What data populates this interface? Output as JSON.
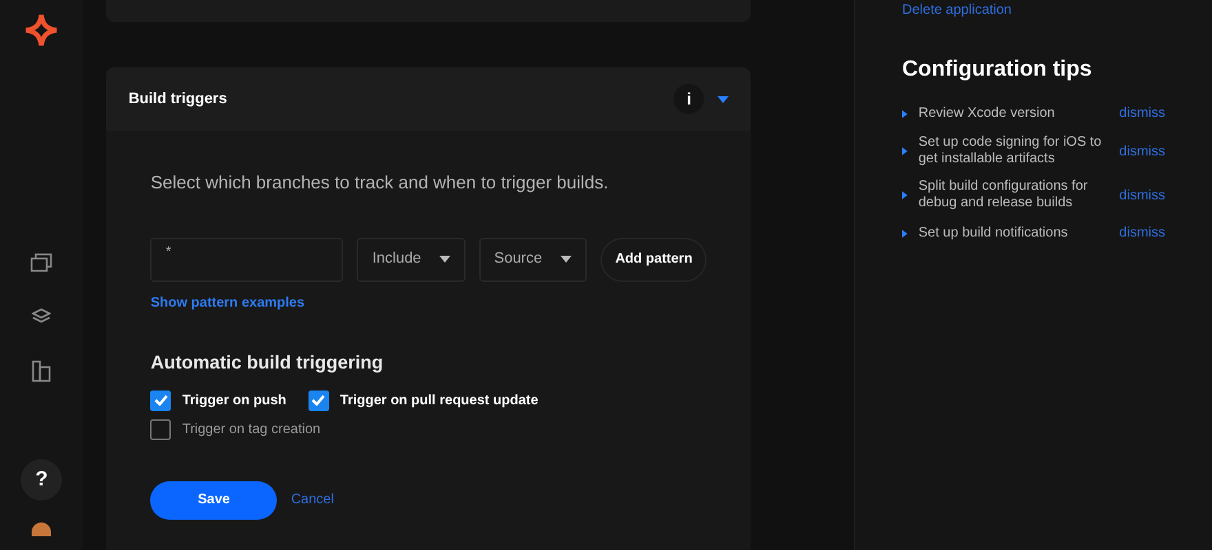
{
  "card": {
    "title": "Build triggers",
    "info_icon": "i",
    "description": "Select which branches to track and when to trigger builds.",
    "pattern": {
      "value": "*",
      "mode": "Include",
      "target": "Source",
      "add_button": "Add pattern"
    },
    "examples_link": "Show pattern examples",
    "section_title": "Automatic build triggering",
    "triggers": [
      {
        "label": "Trigger on push",
        "checked": true
      },
      {
        "label": "Trigger on pull request update",
        "checked": true
      },
      {
        "label": "Trigger on tag creation",
        "checked": false
      }
    ],
    "save": "Save",
    "cancel": "Cancel"
  },
  "sidebar": {
    "help": "?"
  },
  "right": {
    "delete_link": "Delete application",
    "tips_title": "Configuration tips",
    "tips": [
      {
        "text": "Review Xcode version",
        "action": "dismiss"
      },
      {
        "text": "Set up code signing for iOS to get installable artifacts",
        "action": "dismiss"
      },
      {
        "text": "Split build configurations for debug and release builds",
        "action": "dismiss"
      },
      {
        "text": "Set up build notifications",
        "action": "dismiss"
      }
    ]
  }
}
